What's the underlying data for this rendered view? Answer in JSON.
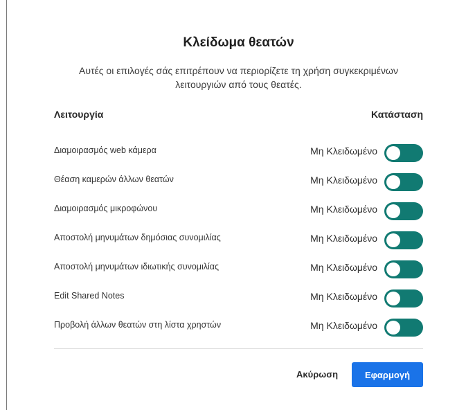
{
  "dialog": {
    "title": "Κλείδωμα θεατών",
    "description_line1": "Αυτές οι επιλογές σάς επιτρέπουν να περιορίζετε τη χρήση συγκεκριμένων",
    "description_line2": "λειτουργιών από τους θεατές.",
    "header": {
      "feature": "Λειτουργία",
      "status": "Κατάσταση"
    },
    "items": [
      {
        "feature": "Διαμοιρασμός web κάμερα",
        "status": "Μη Κλειδωμένο",
        "locked": false
      },
      {
        "feature": "Θέαση καμερών άλλων θεατών",
        "status": "Μη Κλειδωμένο",
        "locked": false
      },
      {
        "feature": "Διαμοιρασμός μικροφώνου",
        "status": "Μη Κλειδωμένο",
        "locked": false
      },
      {
        "feature": "Αποστολή μηνυμάτων δημόσιας συνομιλίας",
        "status": "Μη Κλειδωμένο",
        "locked": false
      },
      {
        "feature": "Αποστολή μηνυμάτων ιδιωτικής συνομιλίας",
        "status": "Μη Κλειδωμένο",
        "locked": false
      },
      {
        "feature": "Edit Shared Notes",
        "status": "Μη Κλειδωμένο",
        "locked": false
      },
      {
        "feature": "Προβολή άλλων θεατών στη λίστα χρηστών",
        "status": "Μη Κλειδωμένο",
        "locked": false
      }
    ],
    "cancel_label": "Ακύρωση",
    "apply_label": "Εφαρμογή"
  },
  "colors": {
    "toggle_track": "#117a72",
    "primary_button": "#1a73e8"
  }
}
